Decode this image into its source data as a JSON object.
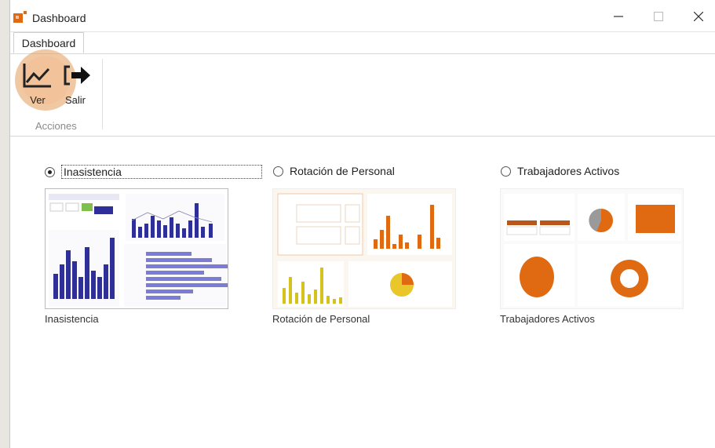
{
  "window": {
    "title": "Dashboard"
  },
  "tabs": [
    {
      "label": "Dashboard"
    }
  ],
  "ribbon": {
    "buttons": [
      {
        "label": "Ver",
        "icon": "line-chart-icon"
      },
      {
        "label": "Salir",
        "icon": "exit-arrow-icon"
      }
    ],
    "group_label": "Acciones"
  },
  "options": [
    {
      "label": "Inasistencia",
      "caption": "Inasistencia",
      "selected": true
    },
    {
      "label": "Rotación de Personal",
      "caption": "Rotación de Personal",
      "selected": false
    },
    {
      "label": "Trabajadores Activos",
      "caption": "Trabajadores Activos",
      "selected": false
    }
  ],
  "colors": {
    "accent": "#e06a12",
    "blue": "#2f2f9a",
    "yellow": "#d6c21c",
    "highlight": "#e39a5a"
  }
}
